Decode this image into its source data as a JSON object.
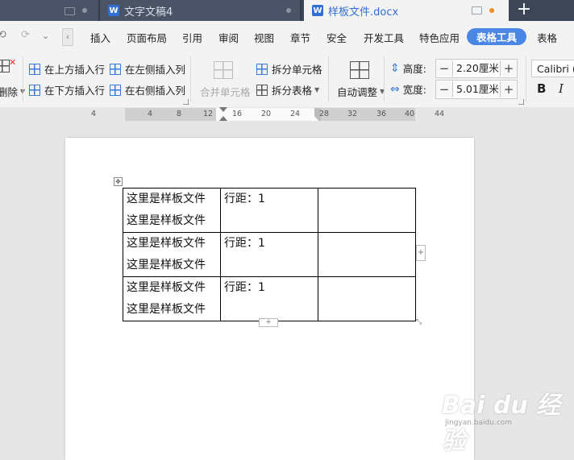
{
  "tabs": [
    {
      "label": "文字文稿4",
      "active": false
    },
    {
      "label": "样板文件.docx",
      "active": true
    }
  ],
  "tabbar": {
    "new_tab": "+",
    "doc_icon": "W"
  },
  "menu": {
    "items": [
      "插入",
      "页面布局",
      "引用",
      "审阅",
      "视图",
      "章节",
      "安全",
      "开发工具",
      "特色应用",
      "表格工具",
      "表格"
    ],
    "active": "表格工具"
  },
  "ribbon": {
    "delete_label": "删除",
    "insert_above": "在上方插入行",
    "insert_below": "在下方插入行",
    "insert_left": "在左侧插入列",
    "insert_right": "在右侧插入列",
    "merge_cells": "合并单元格",
    "split_cells": "拆分单元格",
    "split_table": "拆分表格",
    "auto_fit": "自动调整",
    "height_label": "高度:",
    "height_value": "2.20厘米",
    "width_label": "宽度:",
    "width_value": "5.01厘米",
    "font_name": "Calibri (",
    "bold": "B",
    "italic": "I"
  },
  "ruler": {
    "ticks": [
      "4",
      "4",
      "8",
      "12",
      "16",
      "20",
      "24",
      "28",
      "32",
      "36",
      "40",
      "44"
    ]
  },
  "document": {
    "table": {
      "rows": [
        [
          "这里是样板文件\n这里是样板文件",
          "行距：1",
          ""
        ],
        [
          "这里是样板文件\n这里是样板文件",
          "行距：1",
          ""
        ],
        [
          "这里是样板文件\n这里是样板文件",
          "行距：1",
          ""
        ]
      ]
    }
  },
  "watermark": {
    "logo": "Bai du 经验",
    "sub": "jingyan.baidu.com"
  },
  "colors": {
    "tab_bar": "#3c4656",
    "accent": "#4a87e5",
    "active_tab_text": "#2f6fd6",
    "canvas": "#e6e6e6"
  }
}
